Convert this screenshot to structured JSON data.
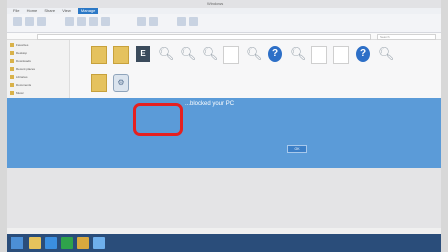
{
  "window": {
    "title": "Windows",
    "ribbon_tabs": [
      "File",
      "Home",
      "Share",
      "View",
      "Manage"
    ],
    "active_tab_index": 4,
    "address": "",
    "search_placeholder": "Search"
  },
  "nav": {
    "items": [
      "Favorites",
      "Desktop",
      "Downloads",
      "Recent places",
      "Libraries",
      "Documents",
      "Music",
      "Pictures",
      "Videos",
      "Computer"
    ]
  },
  "files": [
    {
      "label": "",
      "kind": "folder"
    },
    {
      "label": "",
      "kind": "folder"
    },
    {
      "label": "",
      "kind": "ebook",
      "glyph": "E"
    },
    {
      "label": "",
      "kind": "search"
    },
    {
      "label": "",
      "kind": "search"
    },
    {
      "label": "",
      "kind": "search"
    },
    {
      "label": "",
      "kind": "doc"
    },
    {
      "label": "",
      "kind": "search"
    },
    {
      "label": "",
      "kind": "help",
      "glyph": "?"
    },
    {
      "label": "",
      "kind": "search"
    },
    {
      "label": "",
      "kind": "doc"
    },
    {
      "label": "",
      "kind": "doc"
    },
    {
      "label": "",
      "kind": "help",
      "glyph": "?"
    },
    {
      "label": "",
      "kind": "search"
    },
    {
      "label": "",
      "kind": "folder"
    },
    {
      "label": "",
      "kind": "setup",
      "glyph": "⚙"
    }
  ],
  "dialog": {
    "title": "...blocked your PC",
    "message": "",
    "code": "",
    "ok_label": "OK"
  },
  "taskbar": {
    "apps": [
      "explorer",
      "ie",
      "store",
      "folder",
      "media"
    ],
    "tray_text": ""
  },
  "colors": {
    "dialog_bg": "#5b9bd8",
    "highlight": "#e62020",
    "taskbar": "#2a4d7a"
  }
}
